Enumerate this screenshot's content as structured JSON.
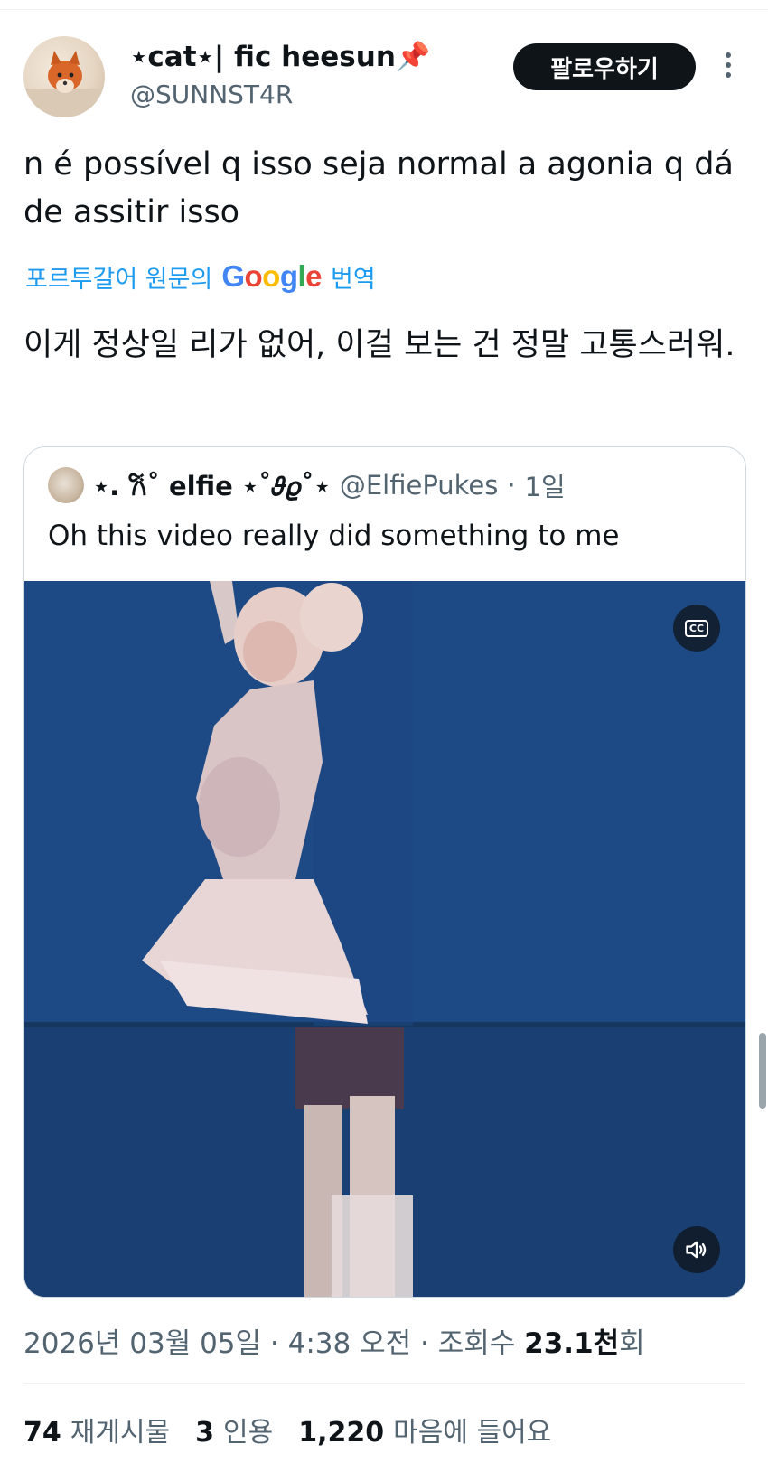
{
  "author": {
    "display_name": "⋆cat⋆| fic heesun📌",
    "handle": "@SUNNST4R"
  },
  "follow_label": "팔로우하기",
  "tweet": {
    "text": "n é possível q isso seja normal a agonia q dá de assitir isso",
    "translate_prefix": "포르투갈어 원문의",
    "translate_suffix": "번역",
    "translated_text": "이게 정상일 리가 없어, 이걸 보는 건 정말 고통스러워."
  },
  "quote": {
    "display_name": "⋆. 𐙚˚ elfie ⋆˚𝜗𝜚˚⋆",
    "handle": "@ElfiePukes",
    "separator": "·",
    "time": "1일",
    "text": "Oh this video really did something to me",
    "cc_label": "CC"
  },
  "meta": {
    "date": "2026년 03월 05일",
    "sep1": "·",
    "time": "4:38 오전",
    "sep2": "·",
    "views_label": "조회수",
    "views_value": "23.1천",
    "views_suffix": "회"
  },
  "stats": {
    "reposts": "74",
    "reposts_label": "재게시물",
    "quotes": "3",
    "quotes_label": "인용",
    "likes": "1,220",
    "likes_label": "마음에 들어요"
  },
  "colors": {
    "link": "#1d9bf0",
    "video_bg": "#1e4b86"
  }
}
